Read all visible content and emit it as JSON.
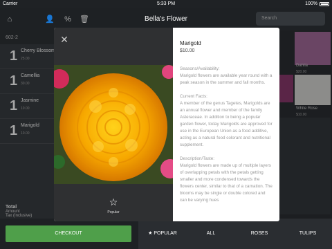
{
  "status": {
    "carrier": "Carrier",
    "time": "5:33 PM",
    "battery": "100%"
  },
  "header": {
    "title": "Bella's Flower",
    "search_placeholder": "Search"
  },
  "order": {
    "id": "602-2",
    "items": [
      {
        "qty": "1",
        "name": "Cherry Blossom",
        "price": "25.00"
      },
      {
        "qty": "1",
        "name": "Camellia",
        "price": "30.00"
      },
      {
        "qty": "1",
        "name": "Jasmine",
        "price": "10.00"
      },
      {
        "qty": "1",
        "name": "Marigold",
        "price": "10.00"
      }
    ],
    "total_label": "Total",
    "amount_label": "Amount",
    "tax_label": "Tax (Inclusive)",
    "checkout_label": "CHECKOUT"
  },
  "tabs": [
    "★ POPULAR",
    "ALL",
    "ROSES",
    "TULIPS"
  ],
  "grid": [
    {
      "label": "Dahlia",
      "price": "$20.00"
    },
    {
      "label": "White Rose",
      "price": "$10.00"
    }
  ],
  "modal": {
    "title": "Marigold",
    "price": "$10.00",
    "favorite_label": "Popular",
    "paragraphs": [
      "Seasons/Availability:",
      "Marigold flowers are available year round with a peak season in the summer and fall months.",
      "Current Facts:",
      "A member of the genus Tagetes, Marigolds are an annual flower and member of the family Asteraceae. In addition to being a popular garden flower, today Marigolds are approved for use in the European Union as a food additive, acting as a natural food colorant and nutritional supplement.",
      "Description/Taste:",
      "Marigold flowers are made up of multiple layers of overlapping petals with the petals getting smaller and more condensed towards the flowers center, similar to that of a carnation. The blooms may be single or double colored and can be varying hues"
    ]
  },
  "colors": {
    "checkout_green": "#4f9f4a",
    "flower_orange": "#f5a400"
  }
}
